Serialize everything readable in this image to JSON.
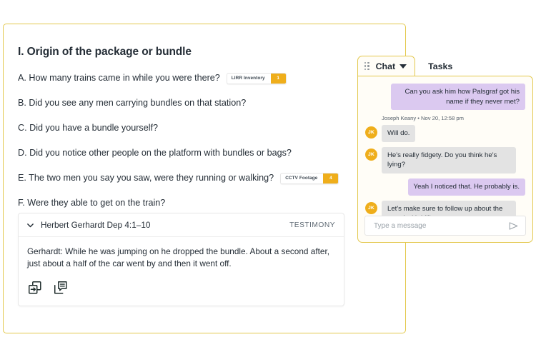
{
  "document": {
    "section_title": "I. Origin of the package or bundle",
    "questions": [
      {
        "text": "A. How many trains came in while you were there?",
        "tag": {
          "label": "LIRR Inventory",
          "count": "1"
        }
      },
      {
        "text": "B. Did you see any men carrying bundles on that station?",
        "tag": null
      },
      {
        "text": "C. Did you have a bundle yourself?",
        "tag": null
      },
      {
        "text": "D. Did you notice other people on the platform with bundles or bags?",
        "tag": null
      },
      {
        "text": "E. The two men you say you saw, were they running or walking?",
        "tag": {
          "label": "CCTV Footage",
          "count": "4"
        }
      },
      {
        "text": "F. Were they able to get on the train?",
        "tag": null
      }
    ]
  },
  "testimony": {
    "title": "Herbert Gerhardt Dep 4:1–10",
    "kind": "TESTIMONY",
    "body": "Gerhardt: While he was jumping on he dropped the bundle. About a second after, just about a half of the car went by and then it went off.",
    "collapse_icon": "chevron-down-icon",
    "actions": [
      {
        "icon": "insert-into-document-icon"
      },
      {
        "icon": "add-comment-icon"
      }
    ]
  },
  "chat": {
    "tabs": [
      {
        "label": "Chat",
        "active": true,
        "caret": "chevron-down-icon",
        "handle": "drag-handle-icon"
      },
      {
        "label": "Tasks",
        "active": false
      }
    ],
    "messages": [
      {
        "direction": "out",
        "text": "Can you ask him how Palsgraf got his name if they never met?",
        "avatar": null,
        "meta": null
      },
      {
        "direction": "in",
        "text": "Will do.",
        "avatar": "JK",
        "meta": "Joseph Keany • Nov 20, 12:58 pm"
      },
      {
        "direction": "in",
        "text": "He's really fidgety. Do you think he's lying?",
        "avatar": "JK",
        "meta": null
      },
      {
        "direction": "out",
        "text": "Yeah I noticed that. He probably is.",
        "avatar": null,
        "meta": null
      },
      {
        "direction": "in",
        "text": "Let's make sure to follow up about the guard with Lillian.",
        "avatar": "JK",
        "meta": null
      }
    ],
    "input": {
      "value": "",
      "placeholder": "Type a message",
      "send_icon": "send-paper-plane-icon"
    }
  },
  "colors": {
    "panel_border": "#e3c84d",
    "accent_gold": "#efae1b",
    "bubble_out": "#dbc9f0",
    "bubble_in": "#e3e3e3",
    "text": "#242d36"
  }
}
